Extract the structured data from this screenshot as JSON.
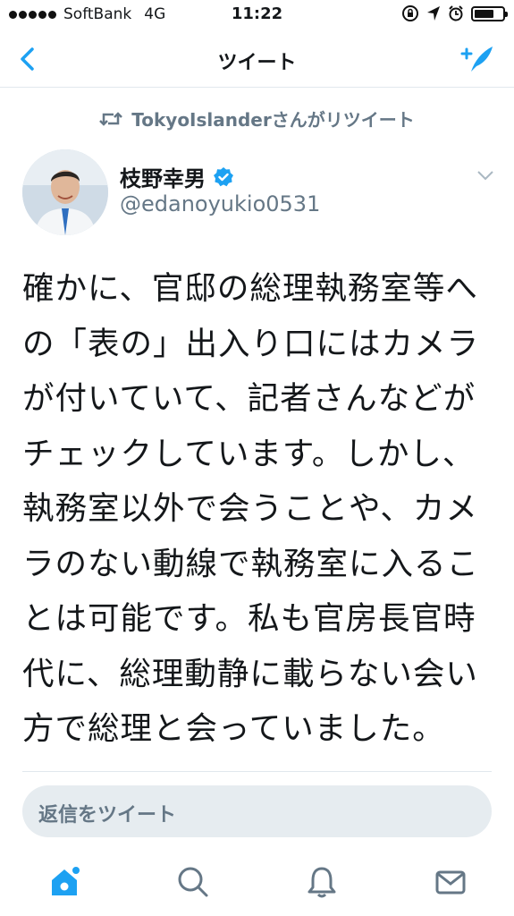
{
  "status_bar": {
    "carrier": "SoftBank",
    "network": "4G",
    "time": "11:22",
    "battery_level": 0.7
  },
  "nav": {
    "title": "ツイート",
    "back_icon": "chevron-left-icon",
    "compose_icon": "compose-tweet-icon"
  },
  "retweet": {
    "label": "TokyoIslanderさんがリツイート",
    "icon": "retweet-icon"
  },
  "author": {
    "name": "枝野幸男",
    "handle": "@edanoyukio0531",
    "verified": true
  },
  "tweet": {
    "text": "確かに、官邸の総理執務室等への「表の」出入り口にはカメラが付いていて、記者さんなどがチェックしています。しかし、執務室以外で会うことや、カメラのない動線で執務室に入ることは可能です。私も官房長官時代に、総理動静に載らない会い方で総理と会っていました。"
  },
  "reply": {
    "placeholder": "返信をツイート"
  },
  "colors": {
    "accent": "#1da1f2",
    "secondary_text": "#657786",
    "divider": "#e1e8ed",
    "reply_bg": "#e6ecf0"
  },
  "tabs": [
    {
      "icon": "home-icon",
      "active": true
    },
    {
      "icon": "search-icon",
      "active": false
    },
    {
      "icon": "notifications-bell-icon",
      "active": false
    },
    {
      "icon": "messages-envelope-icon",
      "active": false
    }
  ]
}
